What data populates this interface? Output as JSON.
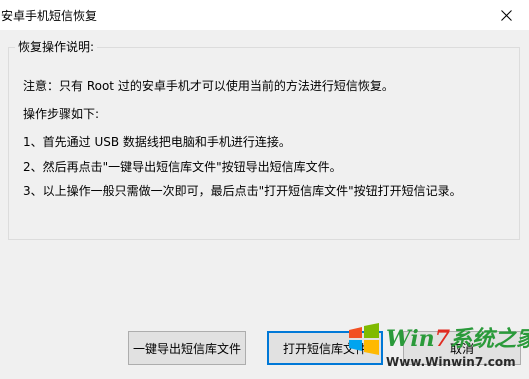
{
  "window": {
    "title": "安卓手机短信恢复",
    "close_icon": "close-icon"
  },
  "group": {
    "legend": "恢复操作说明:",
    "lines": [
      "注意：只有 Root 过的安卓手机才可以使用当前的方法进行短信恢复。",
      "操作步骤如下:",
      "1、首先通过 USB 数据线把电脑和手机进行连接。",
      "2、然后再点击\"一键导出短信库文件\"按钮导出短信库文件。",
      "3、以上操作一般只需做一次即可，最后点击\"打开短信库文件\"按钮打开短信记录。"
    ]
  },
  "buttons": {
    "export_label": "一键导出短信库文件",
    "open_label": "打开短信库文件",
    "cancel_label": "取消"
  },
  "watermark": {
    "brand_win": "Win",
    "brand_7": "7",
    "brand_rest": "系统之家",
    "url": "Www.Winwin7.com"
  },
  "colors": {
    "accent": "#0078d7",
    "dialog_bg": "#f0f0f0",
    "button_bg": "#e1e1e1",
    "button_border": "#adadad",
    "watermark_red": "#e02a20",
    "watermark_green": "#2a9a3a"
  }
}
